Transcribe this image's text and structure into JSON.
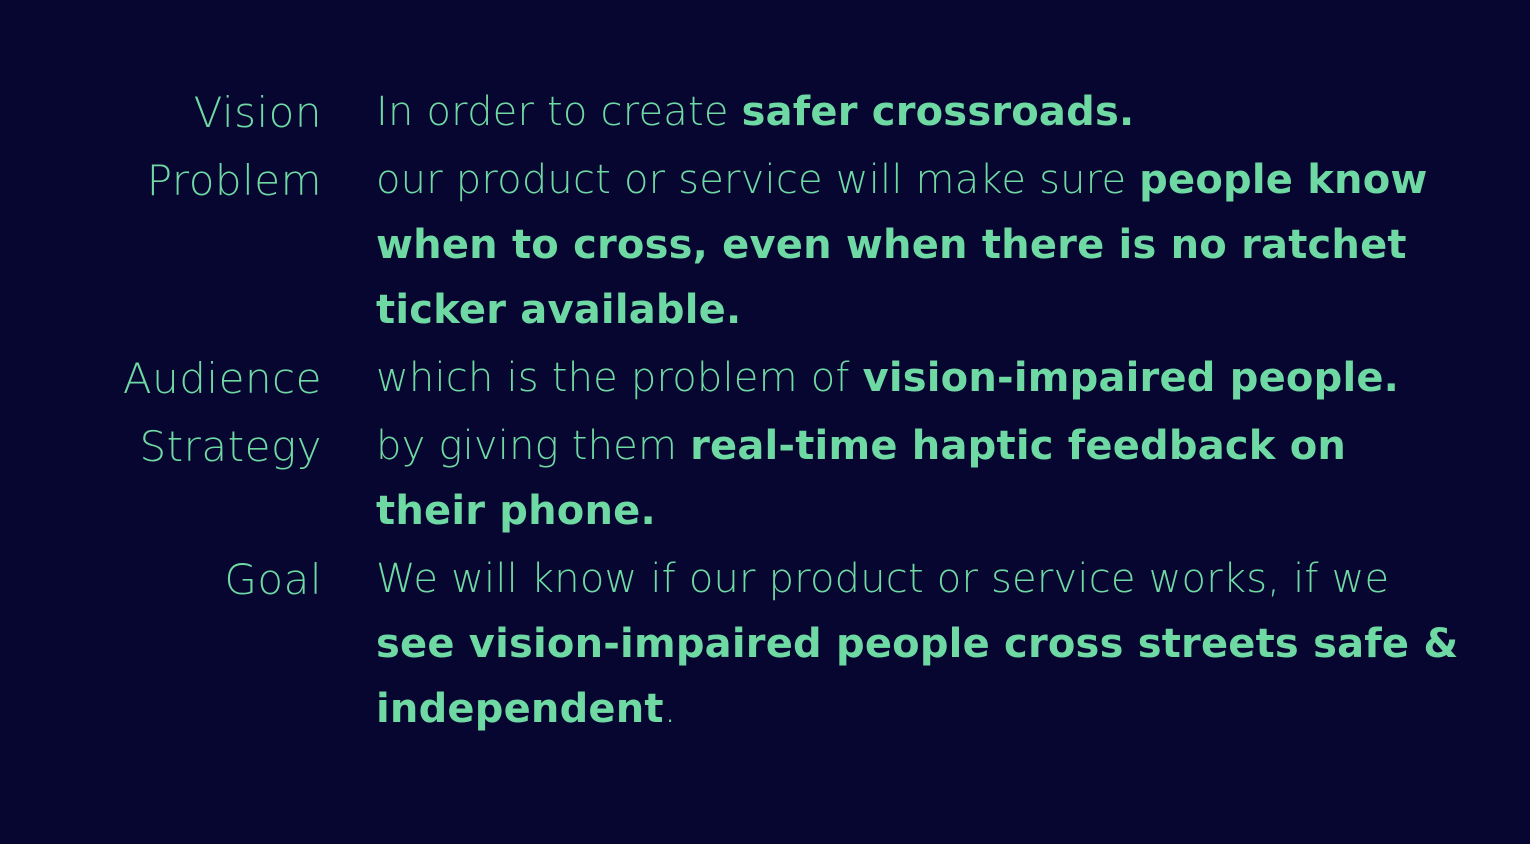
{
  "colors": {
    "background": "#070631",
    "text": "#6fd9a3"
  },
  "rows": [
    {
      "label": "Vision",
      "normal": "In order to create ",
      "strong": "safer crossroads.",
      "tail": ""
    },
    {
      "label": "Problem",
      "normal": "our product or service will make sure ",
      "strong": "people know when to cross, even when there is no ratchet ticker available.",
      "tail": ""
    },
    {
      "label": "Audience",
      "normal": "which is the problem of ",
      "strong": "vision-impaired people.",
      "tail": ""
    },
    {
      "label": "Strategy",
      "normal": "by giving them ",
      "strong": "real-time haptic feedback on their phone.",
      "tail": ""
    },
    {
      "label": "Goal",
      "normal": "We will know if our product or service works, if we ",
      "strong": "see vision-impaired people cross streets safe & independent",
      "tail": "."
    }
  ]
}
